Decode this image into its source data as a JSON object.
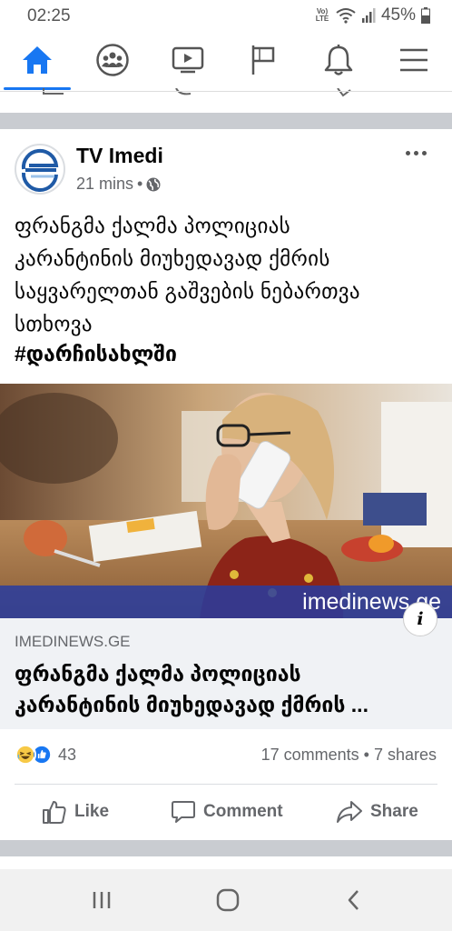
{
  "status_bar": {
    "time": "02:25",
    "network_label": "Vo) LTE",
    "battery": "45%",
    "icons": [
      "wifi-icon",
      "signal-icon",
      "battery-icon"
    ]
  },
  "nav": {
    "items": [
      {
        "name": "home",
        "icon": "home-icon",
        "active": true
      },
      {
        "name": "groups",
        "icon": "groups-icon"
      },
      {
        "name": "watch",
        "icon": "watch-video-icon"
      },
      {
        "name": "pages",
        "icon": "flag-icon"
      },
      {
        "name": "notifications",
        "icon": "bell-icon"
      },
      {
        "name": "menu",
        "icon": "hamburger-menu-icon"
      }
    ],
    "accent_color": "#1877f2"
  },
  "post": {
    "page_name": "TV Imedi",
    "time_ago": "21 mins",
    "audience_icon": "globe-icon",
    "text_lines": [
      "ფრანგმა ქალმა პოლიციას",
      "კარანტინის მიუხედავად ქმრის",
      "საყვარელთან გაშვების ნებართვა",
      "სთხოვა"
    ],
    "hashtag": "#დარჩისახლში",
    "image_watermark": "imedinews.ge",
    "link": {
      "domain": "IMEDINEWS.GE",
      "title_line1": "ფრანგმა ქალმა პოლიციას",
      "title_line2": "კარანტინის მიუხედავად ქმრის ..."
    },
    "reaction_count": "43",
    "engagement": "17 comments • 7 shares",
    "actions": {
      "like": "Like",
      "comment": "Comment",
      "share": "Share"
    }
  },
  "android_nav": {
    "buttons": [
      "recent-apps-icon",
      "home-circle-icon",
      "back-icon"
    ]
  }
}
